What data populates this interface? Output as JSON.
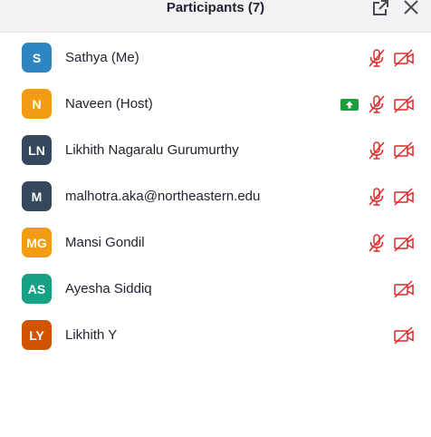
{
  "header": {
    "title": "Participants (7)",
    "popout_icon": "popout-icon",
    "close_icon": "close-icon"
  },
  "colors": {
    "muted_red": "#e02828",
    "share_green": "#1d9e3b",
    "header_bg": "#f2f3f5"
  },
  "participants": [
    {
      "initials": "S",
      "name": "Sathya (Me)",
      "avatar_color": "#2e86c1",
      "mic_muted": true,
      "video_off": true,
      "sharing": false
    },
    {
      "initials": "N",
      "name": "Naveen (Host)",
      "avatar_color": "#f39c12",
      "mic_muted": true,
      "video_off": true,
      "sharing": true
    },
    {
      "initials": "LN",
      "name": "Likhith Nagaralu Gurumurthy",
      "avatar_color": "#34495e",
      "mic_muted": true,
      "video_off": true,
      "sharing": false
    },
    {
      "initials": "M",
      "name": "malhotra.aka@northeastern.edu",
      "avatar_color": "#34495e",
      "mic_muted": true,
      "video_off": true,
      "sharing": false
    },
    {
      "initials": "MG",
      "name": "Mansi Gondil",
      "avatar_color": "#f39c12",
      "mic_muted": true,
      "video_off": true,
      "sharing": false
    },
    {
      "initials": "AS",
      "name": "Ayesha Siddiq",
      "avatar_color": "#16a085",
      "mic_muted": false,
      "video_off": true,
      "sharing": false
    },
    {
      "initials": "LY",
      "name": "Likhith Y",
      "avatar_color": "#d35400",
      "mic_muted": false,
      "video_off": true,
      "sharing": false
    }
  ]
}
